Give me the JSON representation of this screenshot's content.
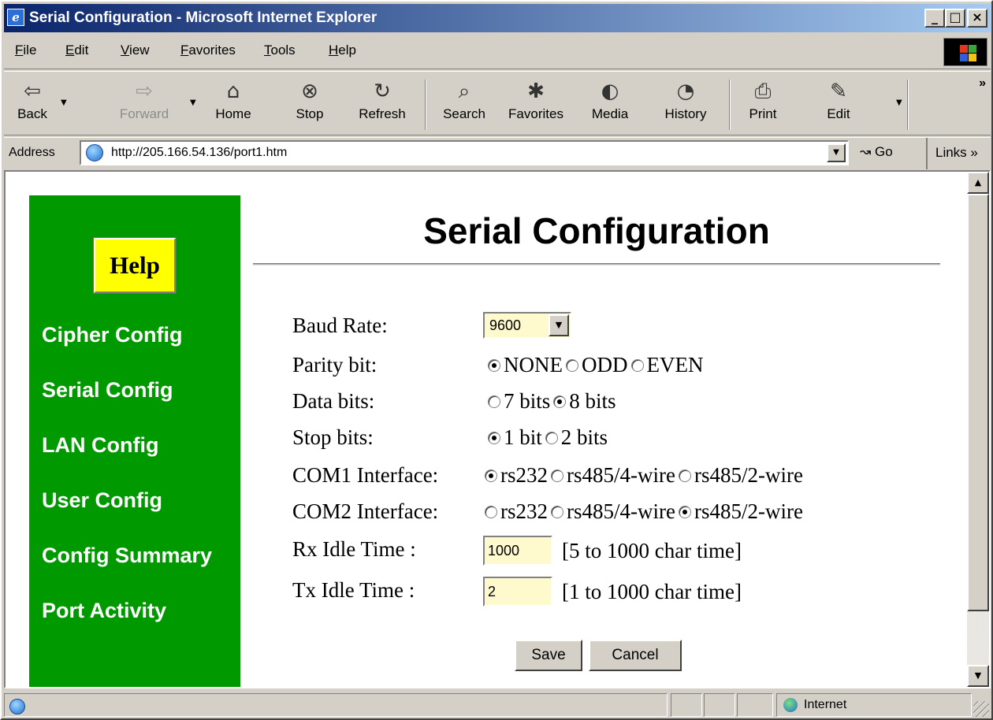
{
  "window": {
    "title": "Serial Configuration - Microsoft Internet Explorer"
  },
  "window_controls": {
    "minimize": "_",
    "maximize": "□",
    "close": "×"
  },
  "menu": [
    "File",
    "Edit",
    "View",
    "Favorites",
    "Tools",
    "Help"
  ],
  "toolbar": {
    "buttons": [
      {
        "label": "Back",
        "icon": "back-arrow-icon",
        "glyph": "⇦",
        "enabled": true
      },
      {
        "label": "Forward",
        "icon": "forward-arrow-icon",
        "glyph": "⇨",
        "enabled": false
      },
      {
        "label": "Home",
        "icon": "home-icon",
        "glyph": "⌂",
        "enabled": true
      },
      {
        "label": "Stop",
        "icon": "stop-icon",
        "glyph": "⊗",
        "enabled": true
      },
      {
        "label": "Refresh",
        "icon": "refresh-icon",
        "glyph": "↻",
        "enabled": true
      },
      {
        "label": "Search",
        "icon": "search-icon",
        "glyph": "⌕",
        "enabled": true
      },
      {
        "label": "Favorites",
        "icon": "favorites-icon",
        "glyph": "✱",
        "enabled": true
      },
      {
        "label": "Media",
        "icon": "media-icon",
        "glyph": "◐",
        "enabled": true
      },
      {
        "label": "History",
        "icon": "history-icon",
        "glyph": "◔",
        "enabled": true
      },
      {
        "label": "Print",
        "icon": "print-icon",
        "glyph": "⎙",
        "enabled": true
      },
      {
        "label": "Edit",
        "icon": "edit-icon",
        "glyph": "✎",
        "enabled": true
      }
    ],
    "more": "»"
  },
  "address": {
    "label": "Address",
    "url": "http://205.166.54.136/port1.htm",
    "go_label": "Go",
    "go_glyph": "↝",
    "links_label": "Links »"
  },
  "sidebar": {
    "help_label": "Help",
    "items": [
      "Cipher Config",
      "Serial Config",
      "LAN Config",
      "User Config",
      "Config Summary",
      "Port Activity"
    ]
  },
  "page": {
    "title": "Serial Configuration",
    "baud_rate": {
      "label": "Baud Rate:",
      "value": "9600"
    },
    "parity": {
      "label": "Parity bit:",
      "options": [
        "NONE",
        "ODD",
        "EVEN"
      ],
      "selected": "NONE"
    },
    "data_bits": {
      "label": "Data bits:",
      "options": [
        "7 bits",
        "8 bits"
      ],
      "selected": "8 bits"
    },
    "stop_bits": {
      "label": "Stop bits:",
      "options": [
        "1 bit",
        "2 bits"
      ],
      "selected": "1 bit"
    },
    "com1": {
      "label": "COM1 Interface:",
      "options": [
        "rs232",
        "rs485/4-wire",
        "rs485/2-wire"
      ],
      "selected": "rs232"
    },
    "com2": {
      "label": "COM2 Interface:",
      "options": [
        "rs232",
        "rs485/4-wire",
        "rs485/2-wire"
      ],
      "selected": "rs485/2-wire"
    },
    "rx_idle": {
      "label": "Rx Idle Time :",
      "value": "1000",
      "hint": "[5 to 1000 char time]"
    },
    "tx_idle": {
      "label": "Tx Idle Time :",
      "value": "2",
      "hint": "[1 to 1000 char time]"
    },
    "save_label": "Save",
    "cancel_label": "Cancel"
  },
  "status": {
    "zone": "Internet"
  }
}
